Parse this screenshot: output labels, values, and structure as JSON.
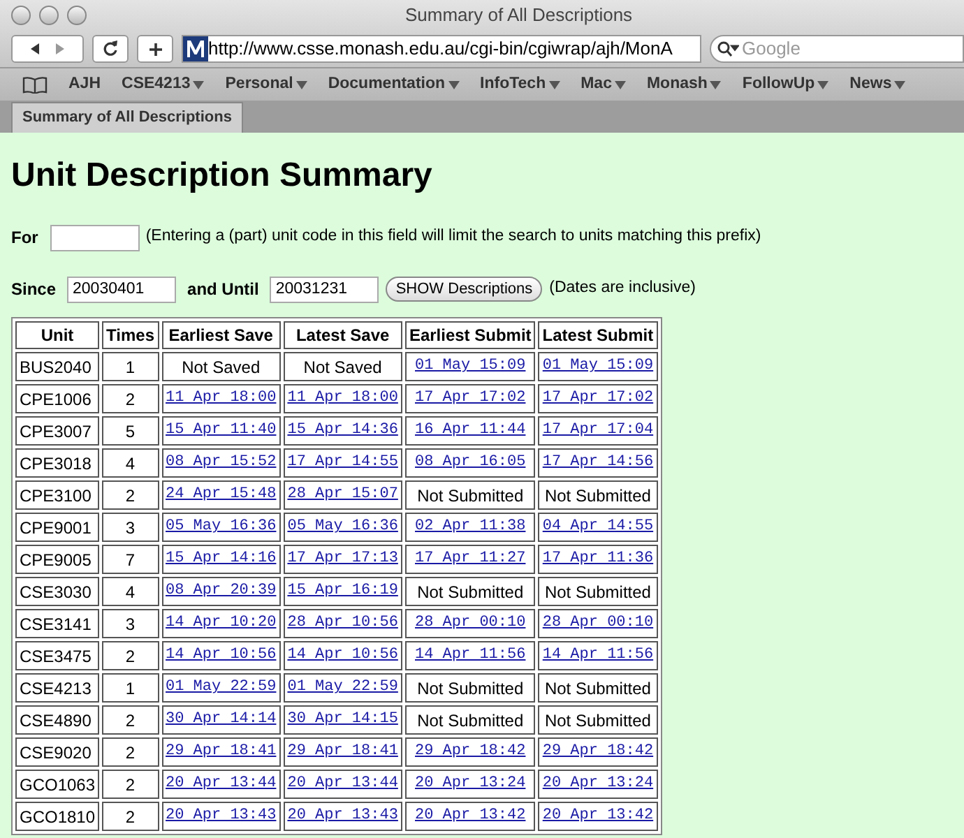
{
  "window": {
    "title": "Summary of All Descriptions"
  },
  "toolbar": {
    "url": "http://www.csse.monash.edu.au/cgi-bin/cgiwrap/ajh/MonA",
    "search_placeholder": "Google"
  },
  "bookmarks": [
    {
      "label": "AJH",
      "menu": false
    },
    {
      "label": "CSE4213",
      "menu": true
    },
    {
      "label": "Personal",
      "menu": true
    },
    {
      "label": "Documentation",
      "menu": true
    },
    {
      "label": "InfoTech",
      "menu": true
    },
    {
      "label": "Mac",
      "menu": true
    },
    {
      "label": "Monash",
      "menu": true
    },
    {
      "label": "FollowUp",
      "menu": true
    },
    {
      "label": "News",
      "menu": true
    }
  ],
  "tabs": [
    {
      "label": "Summary of All Descriptions",
      "selected": true
    }
  ],
  "page": {
    "heading": "Unit Description Summary",
    "for_label": "For",
    "for_hint": "(Entering a (part) unit code in this field will limit the search to units matching this prefix)",
    "since_label": "Since",
    "since_value": "20030401",
    "until_label": "and Until",
    "until_value": "20031231",
    "button": "SHOW Descriptions",
    "dates_note": "(Dates are inclusive)"
  },
  "table": {
    "columns": [
      "Unit",
      "Times",
      "Earliest Save",
      "Latest Save",
      "Earliest Submit",
      "Latest Submit"
    ],
    "rows": [
      [
        {
          "text": "BUS2040",
          "link": false
        },
        {
          "text": "1",
          "link": false
        },
        {
          "text": "Not Saved",
          "link": false
        },
        {
          "text": "Not Saved",
          "link": false
        },
        {
          "text": "01 May 15:09",
          "link": true
        },
        {
          "text": "01 May 15:09",
          "link": true
        }
      ],
      [
        {
          "text": "CPE1006",
          "link": false
        },
        {
          "text": "2",
          "link": false
        },
        {
          "text": "11 Apr 18:00",
          "link": true
        },
        {
          "text": "11 Apr 18:00",
          "link": true
        },
        {
          "text": "17 Apr 17:02",
          "link": true
        },
        {
          "text": "17 Apr 17:02",
          "link": true
        }
      ],
      [
        {
          "text": "CPE3007",
          "link": false
        },
        {
          "text": "5",
          "link": false
        },
        {
          "text": "15 Apr 11:40",
          "link": true
        },
        {
          "text": "15 Apr 14:36",
          "link": true
        },
        {
          "text": "16 Apr 11:44",
          "link": true
        },
        {
          "text": "17 Apr 17:04",
          "link": true
        }
      ],
      [
        {
          "text": "CPE3018",
          "link": false
        },
        {
          "text": "4",
          "link": false
        },
        {
          "text": "08 Apr 15:52",
          "link": true
        },
        {
          "text": "17 Apr 14:55",
          "link": true
        },
        {
          "text": "08 Apr 16:05",
          "link": true
        },
        {
          "text": "17 Apr 14:56",
          "link": true
        }
      ],
      [
        {
          "text": "CPE3100",
          "link": false
        },
        {
          "text": "2",
          "link": false
        },
        {
          "text": "24 Apr 15:48",
          "link": true
        },
        {
          "text": "28 Apr 15:07",
          "link": true
        },
        {
          "text": "Not Submitted",
          "link": false
        },
        {
          "text": "Not Submitted",
          "link": false
        }
      ],
      [
        {
          "text": "CPE9001",
          "link": false
        },
        {
          "text": "3",
          "link": false
        },
        {
          "text": "05 May 16:36",
          "link": true
        },
        {
          "text": "05 May 16:36",
          "link": true
        },
        {
          "text": "02 Apr 11:38",
          "link": true
        },
        {
          "text": "04 Apr 14:55",
          "link": true
        }
      ],
      [
        {
          "text": "CPE9005",
          "link": false
        },
        {
          "text": "7",
          "link": false
        },
        {
          "text": "15 Apr 14:16",
          "link": true
        },
        {
          "text": "17 Apr 17:13",
          "link": true
        },
        {
          "text": "17 Apr 11:27",
          "link": true
        },
        {
          "text": "17 Apr 11:36",
          "link": true
        }
      ],
      [
        {
          "text": "CSE3030",
          "link": false
        },
        {
          "text": "4",
          "link": false
        },
        {
          "text": "08 Apr 20:39",
          "link": true
        },
        {
          "text": "15 Apr 16:19",
          "link": true
        },
        {
          "text": "Not Submitted",
          "link": false
        },
        {
          "text": "Not Submitted",
          "link": false
        }
      ],
      [
        {
          "text": "CSE3141",
          "link": false
        },
        {
          "text": "3",
          "link": false
        },
        {
          "text": "14 Apr 10:20",
          "link": true
        },
        {
          "text": "28 Apr 10:56",
          "link": true
        },
        {
          "text": "28 Apr 00:10",
          "link": true
        },
        {
          "text": "28 Apr 00:10",
          "link": true
        }
      ],
      [
        {
          "text": "CSE3475",
          "link": false
        },
        {
          "text": "2",
          "link": false
        },
        {
          "text": "14 Apr 10:56",
          "link": true
        },
        {
          "text": "14 Apr 10:56",
          "link": true
        },
        {
          "text": "14 Apr 11:56",
          "link": true
        },
        {
          "text": "14 Apr 11:56",
          "link": true
        }
      ],
      [
        {
          "text": "CSE4213",
          "link": false
        },
        {
          "text": "1",
          "link": false
        },
        {
          "text": "01 May 22:59",
          "link": true
        },
        {
          "text": "01 May 22:59",
          "link": true
        },
        {
          "text": "Not Submitted",
          "link": false
        },
        {
          "text": "Not Submitted",
          "link": false
        }
      ],
      [
        {
          "text": "CSE4890",
          "link": false
        },
        {
          "text": "2",
          "link": false
        },
        {
          "text": "30 Apr 14:14",
          "link": true
        },
        {
          "text": "30 Apr 14:15",
          "link": true
        },
        {
          "text": "Not Submitted",
          "link": false
        },
        {
          "text": "Not Submitted",
          "link": false
        }
      ],
      [
        {
          "text": "CSE9020",
          "link": false
        },
        {
          "text": "2",
          "link": false
        },
        {
          "text": "29 Apr 18:41",
          "link": true
        },
        {
          "text": "29 Apr 18:41",
          "link": true
        },
        {
          "text": "29 Apr 18:42",
          "link": true
        },
        {
          "text": "29 Apr 18:42",
          "link": true
        }
      ],
      [
        {
          "text": "GCO1063",
          "link": false
        },
        {
          "text": "2",
          "link": false
        },
        {
          "text": "20 Apr 13:44",
          "link": true
        },
        {
          "text": "20 Apr 13:44",
          "link": true
        },
        {
          "text": "20 Apr 13:24",
          "link": true
        },
        {
          "text": "20 Apr 13:24",
          "link": true
        }
      ],
      [
        {
          "text": "GCO1810",
          "link": false
        },
        {
          "text": "2",
          "link": false
        },
        {
          "text": "20 Apr 13:43",
          "link": true
        },
        {
          "text": "20 Apr 13:43",
          "link": true
        },
        {
          "text": "20 Apr 13:42",
          "link": true
        },
        {
          "text": "20 Apr 13:42",
          "link": true
        }
      ]
    ]
  }
}
